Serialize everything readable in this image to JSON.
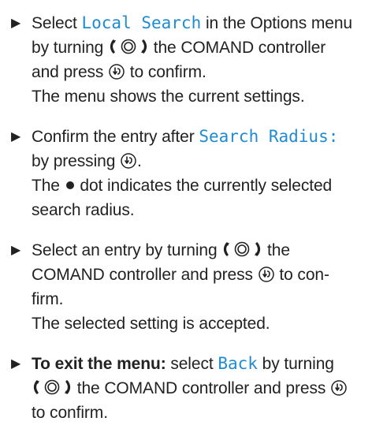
{
  "steps": [
    {
      "t1": "Select ",
      "display": "Local Search",
      "t2": " in the Options menu",
      "t3": "by turning ",
      "t4": " the COMAND controller",
      "t5": "and press ",
      "t6": " to confirm.",
      "result": "The menu shows the current settings."
    },
    {
      "t1": "Confirm the entry after ",
      "display": "Search Radius:",
      "t2": "by pressing ",
      "t3": ".",
      "r1": "The ",
      "r2": " dot indicates the currently selected",
      "r3": "search radius."
    },
    {
      "t1": "Select an entry by turning ",
      "t2": " the",
      "t3": "COMAND controller and press ",
      "t4": " to con-",
      "t5": "firm.",
      "result": "The selected setting is accepted."
    },
    {
      "bold": "To exit the menu:",
      "t1": " select ",
      "display": "Back",
      "t2": " by turning",
      "t3": " the COMAND controller and press ",
      "t4": "to confirm."
    }
  ],
  "icons": {
    "bullet": "▶",
    "controller": "turn-controller-icon",
    "press": "press-controller-icon"
  },
  "colors": {
    "display_text": "#1f8bd1",
    "body_text": "#222222"
  }
}
